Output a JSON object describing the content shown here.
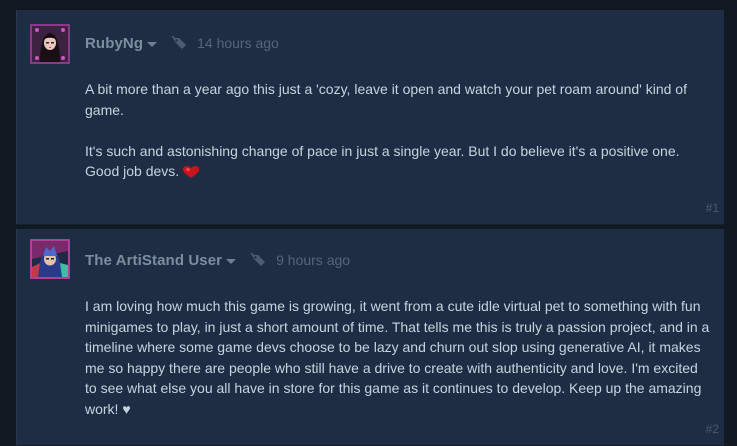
{
  "comments": [
    {
      "author": "RubyNg",
      "timestamp": "14 hours ago",
      "paragraphs": [
        "A bit more than a year ago this just a 'cozy, leave it open and watch your pet roam around' kind of game.",
        "It's such and astonishing change of pace in just a single year. But I do believe it's a positive one.",
        "Good job devs."
      ],
      "emoticon": "heart-emoticon",
      "index": "#1",
      "avatar_frame_color": "#8a3a8a"
    },
    {
      "author": "The ArtiStand User",
      "timestamp": "9 hours ago",
      "paragraphs": [
        "I am loving how much this game is growing, it went from a cute idle virtual pet to something with fun minigames to play, in just a short amount of time. That tells me this is truly a passion project, and in a timeline where some game devs choose to be lazy and churn out slop using generative AI, it makes me so happy there are people who still have a drive to create with authenticity and love. I'm excited to see what else you all have in store for this game as it continues to develop. Keep up the amazing work! ♥"
      ],
      "index": "#2",
      "avatar_frame_color": "#b0409a"
    }
  ],
  "colors": {
    "page_bg": "#101822",
    "comment_bg": "#1e2d44",
    "body_text": "#c6d4df",
    "author_text": "#7c8d9e",
    "timestamp_text": "#56657a",
    "index_text": "#4a5a6c"
  }
}
